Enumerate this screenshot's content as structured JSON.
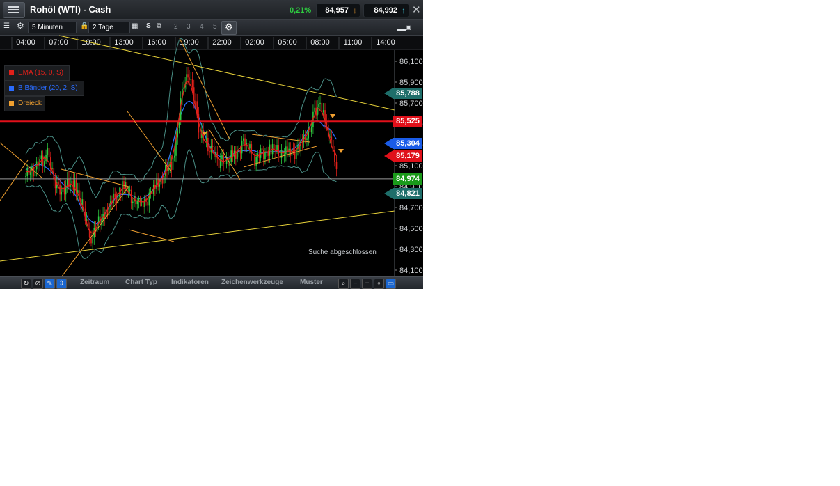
{
  "header": {
    "title": "Rohöl (WTI) - Cash",
    "change": "0,21%",
    "bid": "84,957",
    "ask": "84,992",
    "bid_color": "#e89a2e",
    "ask_color": "#3fb8c8"
  },
  "toolbar": {
    "interval": "5 Minuten",
    "range": "2 Tage",
    "s_label": "S",
    "layouts": [
      "2",
      "3",
      "4",
      "5"
    ]
  },
  "legend": [
    {
      "label": "EMA (15, 0, S)",
      "color": "#e0201a"
    },
    {
      "label": "B Bänder (20, 2, S)",
      "color": "#2a6cff"
    },
    {
      "label": "Dreieck",
      "color": "#f0a030"
    }
  ],
  "price_tags": [
    {
      "value": "85,788",
      "color": "#1e6e6a"
    },
    {
      "value": "85,525",
      "color": "#e0101a"
    },
    {
      "value": "85,304",
      "color": "#1a5ce8"
    },
    {
      "value": "85,179",
      "color": "#e0101a"
    },
    {
      "value": "84,974",
      "color": "#1a9a1a"
    },
    {
      "value": "84,821",
      "color": "#1e6e6a"
    }
  ],
  "status_text": "Suche abgeschlossen",
  "bottom_menu": [
    "Zeitraum",
    "Chart Typ",
    "Indikatoren",
    "Zeichenwerkzeuge",
    "Muster"
  ],
  "chart_data": {
    "type": "candlestick",
    "x_ticks": [
      "04:00",
      "07:00",
      "10:00",
      "13:00",
      "16:00",
      "19:00",
      "22:00",
      "02:00",
      "05:00",
      "08:00",
      "11:00",
      "14:00"
    ],
    "y_ticks": [
      "86,100",
      "85,900",
      "85,700",
      "85,500",
      "85,300",
      "85,100",
      "84,900",
      "84,700",
      "84,500",
      "84,300",
      "84,100"
    ],
    "ylim": [
      84.0,
      86.2
    ],
    "horizontal_lines": [
      85.525,
      84.974
    ],
    "close_path": [
      [
        "04:00",
        85.0
      ],
      [
        "06:00",
        85.2
      ],
      [
        "07:00",
        84.85
      ],
      [
        "08:30",
        84.95
      ],
      [
        "10:00",
        84.42
      ],
      [
        "11:30",
        84.7
      ],
      [
        "13:00",
        84.9
      ],
      [
        "14:30",
        84.7
      ],
      [
        "16:00",
        84.9
      ],
      [
        "17:30",
        85.15
      ],
      [
        "18:30",
        85.9
      ],
      [
        "19:00",
        86.0
      ],
      [
        "20:00",
        85.4
      ],
      [
        "21:00",
        85.25
      ],
      [
        "22:00",
        85.12
      ],
      [
        "23:30",
        85.2
      ],
      [
        "01:00",
        85.35
      ],
      [
        "02:00",
        85.18
      ],
      [
        "03:30",
        85.26
      ],
      [
        "05:00",
        85.2
      ],
      [
        "06:30",
        85.3
      ],
      [
        "07:30",
        85.6
      ],
      [
        "08:00",
        85.72
      ],
      [
        "08:45",
        85.45
      ],
      [
        "09:20",
        85.2
      ],
      [
        "09:40",
        84.85
      ]
    ]
  }
}
